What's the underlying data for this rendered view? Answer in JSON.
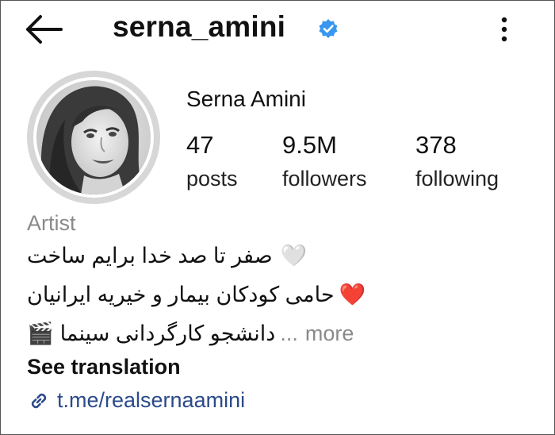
{
  "header": {
    "username": "serna_amini",
    "verified_icon": "verified-badge-icon",
    "back_icon": "arrow-left-icon",
    "menu_icon": "more-vertical-icon"
  },
  "profile": {
    "display_name": "Serna Amini",
    "avatar_icon": "profile-photo"
  },
  "stats": {
    "posts": {
      "value": "47",
      "label": "posts"
    },
    "followers": {
      "value": "9.5M",
      "label": "followers"
    },
    "following": {
      "value": "378",
      "label": "following"
    }
  },
  "bio": {
    "category": "Artist",
    "line1": "صفر تا صد خدا برایم ساخت",
    "line1_emoji": "🤍",
    "line2": "حامی کودکان بیمار و خیریه ایرانیان",
    "line2_emoji": "❤️",
    "line3": "دانشجو کارگردانی سینما",
    "line3_emoji": "🎬",
    "ellipsis": "...",
    "more_label": "more",
    "see_translation": "See translation",
    "link": "t.me/realsernaamini",
    "link_icon": "link-icon"
  },
  "colors": {
    "verified_blue": "#3897f0",
    "link_blue": "#2b4a8a",
    "secondary_text": "#8a8a8a"
  }
}
